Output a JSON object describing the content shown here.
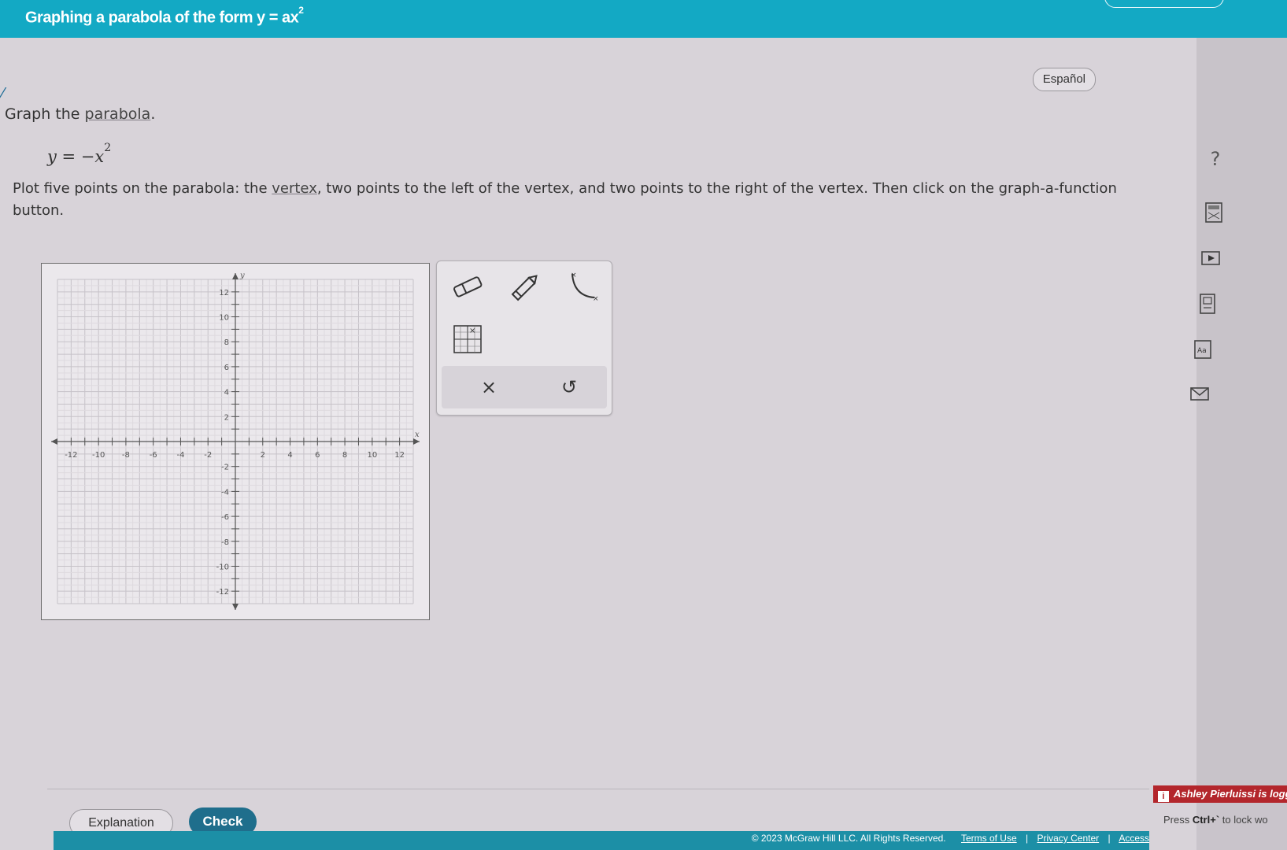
{
  "header": {
    "title_prefix": "Graphing a parabola of the form y = ax",
    "title_exponent": "2"
  },
  "language_button": "Español",
  "prompt": {
    "text": "Graph the ",
    "link": "parabola",
    "end": "."
  },
  "equation": {
    "lhs": "y = −x",
    "exponent": "2"
  },
  "instructions": {
    "part1": "Plot five points on the parabola: the ",
    "vertex_link": "vertex",
    "part2": ", two points to the left of the vertex, and two points to the right of the vertex. Then click on the graph-a-function button."
  },
  "graph": {
    "x_axis_label": "x",
    "y_axis_label": "y",
    "x_range": [
      -13,
      13
    ],
    "y_range": [
      -13,
      13
    ],
    "x_tick_labels": [
      "-12",
      "-10",
      "-8",
      "-6",
      "-4",
      "-2",
      "2",
      "4",
      "6",
      "8",
      "10",
      "12"
    ],
    "y_tick_labels": [
      "12",
      "10",
      "8",
      "6",
      "4",
      "2",
      "-2",
      "-4",
      "-6",
      "-8",
      "-10",
      "-12"
    ],
    "grid": true
  },
  "tools": {
    "eraser": "eraser-icon",
    "pencil": "pencil-icon",
    "graph_function": "graph-function-icon",
    "table": "point-table-icon",
    "clear_symbol": "×",
    "undo_symbol": "↺"
  },
  "side_icons": {
    "help": "?",
    "calculator": "calculator-icon",
    "video": "video-icon",
    "ebook": "ebook-icon",
    "glossary": "glossary-icon",
    "message": "message-icon"
  },
  "buttons": {
    "explanation": "Explanation",
    "check": "Check"
  },
  "footer": {
    "copyright": "© 2023 McGraw Hill LLC. All Rights Reserved.",
    "terms": "Terms of Use",
    "privacy": "Privacy Center",
    "accessibility": "Access",
    "separator": "|"
  },
  "login_banner": {
    "text": "Ashley Pierluissi is logg"
  },
  "lock_hint": {
    "prefix": "Press ",
    "keys": "Ctrl+`",
    "suffix": " to lock wo"
  },
  "colors": {
    "header": "#13a9c4",
    "check_button": "#1f6e8c",
    "footer": "#1c8fa6",
    "login_banner": "#b3262c"
  }
}
